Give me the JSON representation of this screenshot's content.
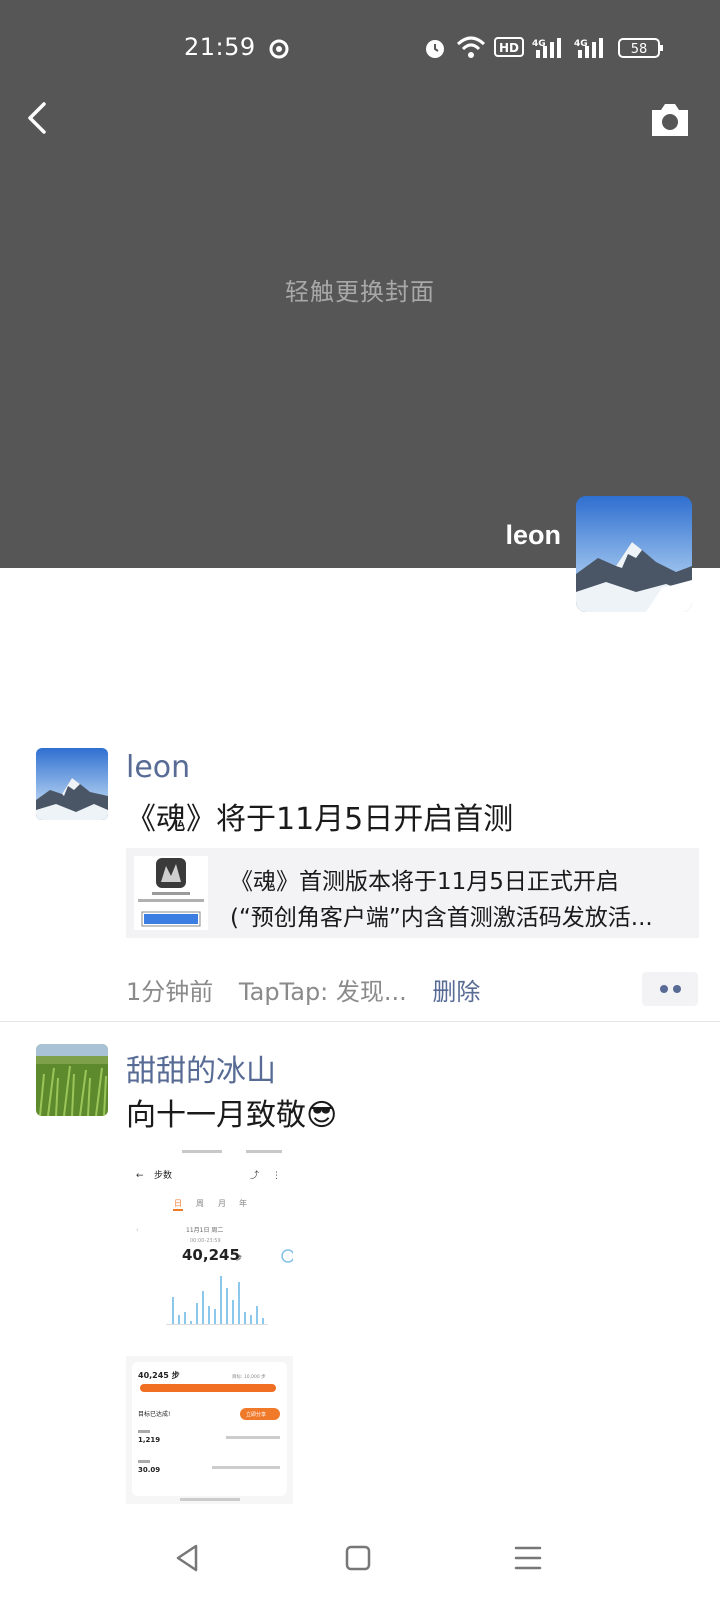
{
  "status_bar": {
    "time": "21:59",
    "battery": "58",
    "icons": [
      "weather-icon",
      "alarm-icon",
      "wifi-icon",
      "hd-icon",
      "signal-4g-icon",
      "signal-4g-icon",
      "battery-icon"
    ],
    "hd_label": "HD",
    "net_label": "4G"
  },
  "cover": {
    "hint": "轻触更换封面",
    "owner_name": "leon",
    "back_icon": "chevron-left-icon",
    "camera_icon": "camera-icon"
  },
  "posts": [
    {
      "nickname": "leon",
      "text": "《魂》将于11月5日开启首测",
      "share": {
        "line1": "《魂》首测版本将于11月5日正式开启",
        "line2": "(“预创角客户端”内含首测激活码发放活..."
      },
      "time": "1分钟前",
      "source": "TapTap: 发现...",
      "delete_label": "删除"
    },
    {
      "nickname": "甜甜的冰山",
      "text": "向十一月致敬",
      "emoji": "😎",
      "screenshot": {
        "title": "步数",
        "tabs": [
          "日",
          "周",
          "月",
          "年"
        ],
        "date": "11月1日 周二",
        "range": "00:00-23:59",
        "steps": "40,245",
        "steps_unit": "步",
        "card_steps": "40,245 步",
        "goal": "目标: 10,000 步",
        "goal_reached": "目标已达成!",
        "share_btn": "立即分享",
        "calories": "1,219",
        "distance": "30.09",
        "chart_values": [
          0.45,
          0.15,
          0.2,
          0.05,
          0.35,
          0.55,
          0.3,
          0.25,
          0.8,
          0.6,
          0.4,
          0.7,
          0.2,
          0.15,
          0.3,
          0.1
        ]
      }
    }
  ],
  "nav": {
    "back_icon": "triangle-back-icon",
    "home_icon": "square-home-icon",
    "menu_icon": "menu-lines-icon"
  }
}
